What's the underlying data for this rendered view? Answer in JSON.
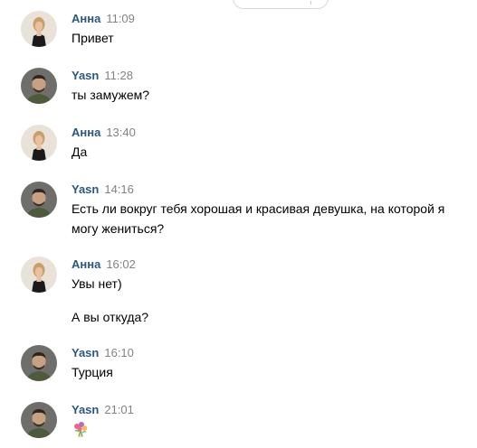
{
  "colors": {
    "author": "#2a5885",
    "time": "#828282",
    "text": "#000000",
    "border": "#d3d9de"
  },
  "messages": [
    {
      "author": "Анна",
      "time": "11:09",
      "text": "Привет",
      "avatar": "anna-avatar"
    },
    {
      "author": "Yasn",
      "time": "11:28",
      "text": "ты замужем?",
      "avatar": "yasn-avatar"
    },
    {
      "author": "Анна",
      "time": "13:40",
      "text": "Да",
      "avatar": "anna-avatar"
    },
    {
      "author": "Yasn",
      "time": "14:16",
      "text_line1": "Есть ли вокруг тебя хорошая и красивая девушка, на которой я",
      "text_line2": "могу жениться?",
      "avatar": "yasn-avatar"
    },
    {
      "author": "Анна",
      "time": "16:02",
      "text": "Увы нет)",
      "text_extra": "А вы откуда?",
      "avatar": "anna-avatar"
    },
    {
      "author": "Yasn",
      "time": "16:10",
      "text": "Турция",
      "avatar": "yasn-avatar"
    },
    {
      "author": "Yasn",
      "time": "21:01",
      "sticker": "flower-bouquet-icon",
      "avatar": "yasn-avatar"
    }
  ]
}
